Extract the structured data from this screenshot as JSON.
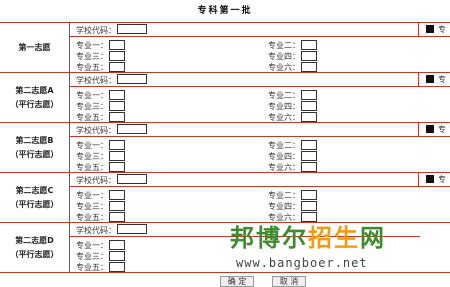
{
  "title": "专科第一批",
  "code_label": "学校代码：",
  "spec_cut": "专",
  "majors": [
    "专业一：",
    "专业二：",
    "专业三：",
    "专业四：",
    "专业五：",
    "专业六："
  ],
  "sections": [
    {
      "name": "第一志愿",
      "sub": ""
    },
    {
      "name": "第二志愿A",
      "sub": "（平行志愿）"
    },
    {
      "name": "第二志愿B",
      "sub": "（平行志愿）"
    },
    {
      "name": "第二志愿C",
      "sub": "（平行志愿）"
    },
    {
      "name": "第二志愿D",
      "sub": "（平行志愿）"
    }
  ],
  "watermark": {
    "text_green": "邦博尔",
    "text_orange": "招生",
    "text_green2": "网",
    "url": "www.bangboer.net"
  },
  "buttons": {
    "confirm": "确 定",
    "cancel": "取 消"
  },
  "colors": {
    "border": "#c0392b",
    "watermark_green": "#3d8b2e",
    "watermark_orange": "#f39c12"
  }
}
